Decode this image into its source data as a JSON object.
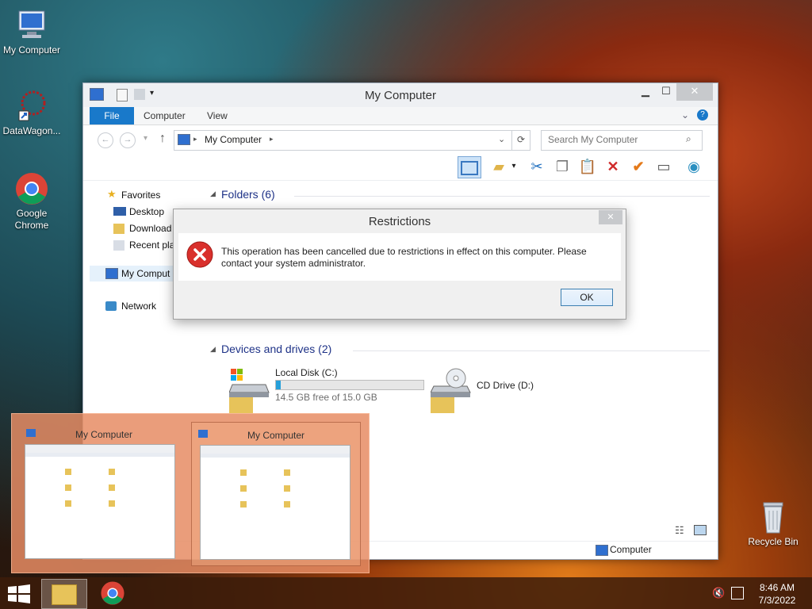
{
  "desktop": {
    "icons": [
      {
        "label": "My Computer"
      },
      {
        "label": "DataWagon..."
      },
      {
        "label": "Google Chrome"
      },
      {
        "label": "Recycle Bin"
      }
    ]
  },
  "explorer": {
    "title": "My Computer",
    "tabs": [
      "File",
      "Computer",
      "View"
    ],
    "address": "My Computer",
    "search_placeholder": "Search My Computer",
    "nav": {
      "favorites": "Favorites",
      "desktop": "Desktop",
      "downloads": "Download",
      "recent": "Recent pla",
      "mycomputer": "My Comput",
      "network": "Network"
    },
    "groups": {
      "folders": "Folders (6)",
      "devices": "Devices and drives (2)"
    },
    "drives": [
      {
        "name": "Local Disk (C:)",
        "free": "14.5 GB free of 15.0 GB",
        "used_fraction": 0.033
      },
      {
        "name": "CD Drive (D:)"
      }
    ],
    "status_location": "Computer"
  },
  "dialog": {
    "title": "Restrictions",
    "message": "This operation has been cancelled due to restrictions in effect on this computer. Please contact your system administrator.",
    "ok": "OK"
  },
  "taskbar": {
    "time": "8:46 AM",
    "date": "7/3/2022",
    "thumbnails": [
      "My Computer",
      "My Computer"
    ]
  },
  "colors": {
    "accent": "#1979ca",
    "error": "#d9302c"
  }
}
